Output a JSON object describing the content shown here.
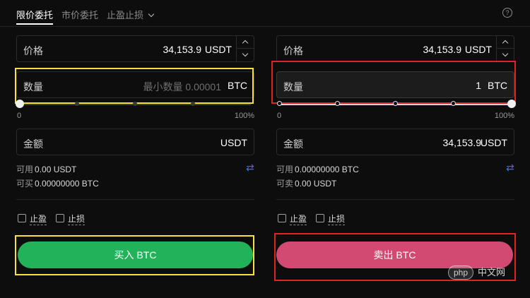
{
  "tabs": [
    {
      "label": "限价委托",
      "active": true
    },
    {
      "label": "市价委托",
      "active": false
    },
    {
      "label": "止盈止损",
      "active": false,
      "dropdown": true
    }
  ],
  "help_glyph": "?",
  "buy": {
    "price_label": "价格",
    "price_value": "34,153.9",
    "price_unit": "USDT",
    "qty_label": "数量",
    "qty_placeholder": "最小数量 0.00001",
    "qty_unit": "BTC",
    "slider_min": "0",
    "slider_max": "100%",
    "slider_value": 0,
    "amount_label": "金额",
    "amount_unit": "USDT",
    "available_label": "可用",
    "available_value": "0.00 USDT",
    "can_label": "可买",
    "can_value": "0.00000000 BTC",
    "tp_label": "止盈",
    "sl_label": "止损",
    "button_label": "买入 BTC"
  },
  "sell": {
    "price_label": "价格",
    "price_value": "34,153.9",
    "price_unit": "USDT",
    "qty_label": "数量",
    "qty_value": "1",
    "qty_unit": "BTC",
    "slider_min": "0",
    "slider_max": "100%",
    "slider_value": 1.0,
    "amount_label": "金额",
    "amount_value": "34,153.9",
    "amount_unit": "USDT",
    "available_label": "可用",
    "available_value": "0.00000000 BTC",
    "can_label": "可卖",
    "can_value": "0.00 USDT",
    "tp_label": "止盈",
    "sl_label": "止损",
    "button_label": "卖出 BTC"
  },
  "icons": {
    "swap": "⇄"
  },
  "watermark": {
    "badge": "php",
    "text": "中文网"
  },
  "colors": {
    "buy": "#22b35a",
    "sell": "#d24a72",
    "highlight_buy": "#f4e23a",
    "highlight_sell": "#e02424",
    "swap_icon": "#3b6df0"
  }
}
